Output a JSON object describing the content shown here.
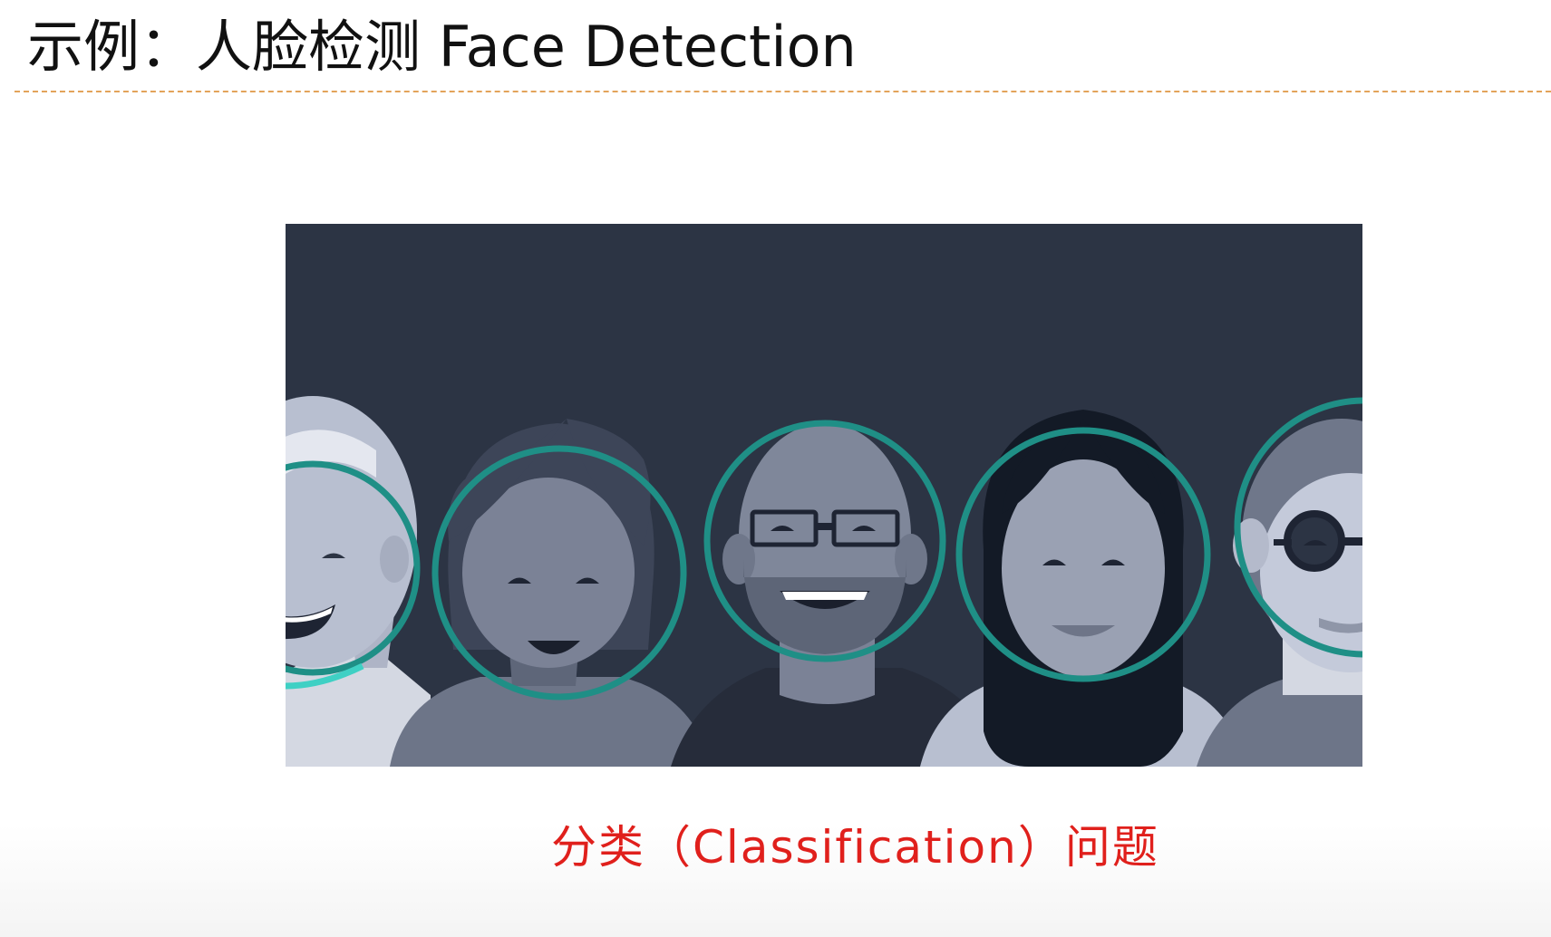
{
  "slide": {
    "title": "示例：人脸检测 Face Detection",
    "caption": "分类（Classification）问题"
  },
  "colors": {
    "title_text": "#111111",
    "divider": "#e3a35a",
    "caption_text": "#e0201c",
    "figure_background": "#2c3444",
    "detection_circle": "#1f8f86"
  },
  "illustration": {
    "faces": [
      {
        "name": "face-1-elderly-man",
        "detected": true
      },
      {
        "name": "face-2-woman-short-hair",
        "detected": true
      },
      {
        "name": "face-3-bald-man-glasses",
        "detected": true
      },
      {
        "name": "face-4-woman-long-hair",
        "detected": true
      },
      {
        "name": "face-5-man-round-glasses",
        "detected": true
      }
    ]
  }
}
